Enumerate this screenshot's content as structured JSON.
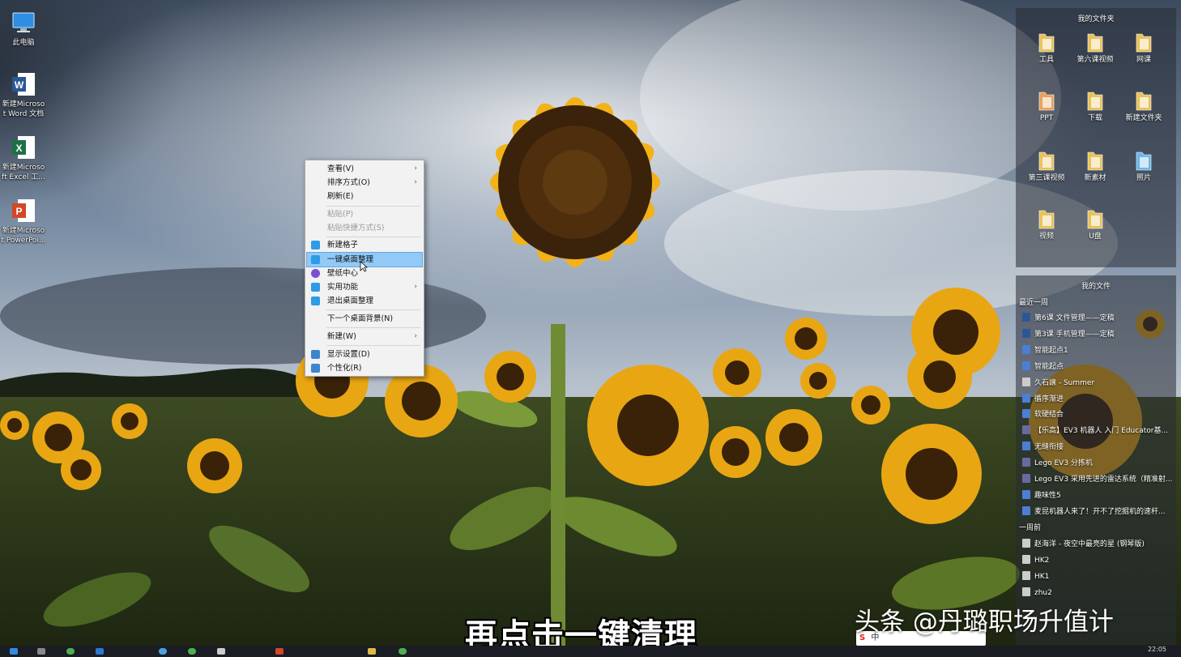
{
  "desktop": {
    "icons": [
      {
        "name": "computer-icon",
        "label": "此电脑"
      },
      {
        "name": "word-icon",
        "label": "新建Microso\nt Word 文档"
      },
      {
        "name": "excel-icon",
        "label": "新建Microso\nft Excel 工..."
      },
      {
        "name": "powerpoint-icon",
        "label": "新建Microso\nt PowerPoi..."
      }
    ]
  },
  "context_menu": {
    "items": {
      "view": "查看(V)",
      "sort": "排序方式(O)",
      "refresh": "刷新(E)",
      "paste": "粘贴(P)",
      "paste_shortcut": "粘贴快捷方式(S)",
      "new_fence": "新建格子",
      "one_click_organize": "一键桌面整理",
      "wallpaper_center": "壁纸中心",
      "utilities": "实用功能",
      "exit_organize": "退出桌面整理",
      "next_background": "下一个桌面背景(N)",
      "new": "新建(W)",
      "display_settings": "显示设置(D)",
      "personalize": "个性化(R)"
    },
    "submenu_arrow": "›",
    "colors": {
      "hover": "#91c9f7"
    }
  },
  "fence_folders": {
    "title": "我的文件夹",
    "folders": [
      "工具",
      "第六课视频",
      "网课",
      "PPT",
      "下载",
      "新建文件夹",
      "第三课视频",
      "新素材",
      "照片",
      "视频",
      "U盘"
    ]
  },
  "fence_files": {
    "title": "我的文件",
    "group_recent": "最近一周",
    "recent": [
      "第6课 文件管理——定稿",
      "第3课 手机管理——定稿",
      "智能起点1",
      "智能起点",
      "久石譲 - Summer",
      "循序渐进",
      "软硬结合",
      "【乐高】EV3 机器人 入门 Educator基...",
      "无缝衔接",
      "Lego EV3 分拣机",
      "Lego EV3 采用先进的雷达系统（精准射...",
      "趣味性5",
      "麦昆机器人来了！开不了挖掘机的速杆..."
    ],
    "group_week_ago": "一周前",
    "older": [
      "赵海洋 - 夜空中最亮的星 (钢琴版)",
      "HK2",
      "HK1",
      "zhu2"
    ]
  },
  "overlay": {
    "watermark": "头条 @丹璐职场升值计",
    "caption": "再点击一键清理"
  },
  "taskbar": {
    "clock": "22:05",
    "ime_label": "中"
  }
}
